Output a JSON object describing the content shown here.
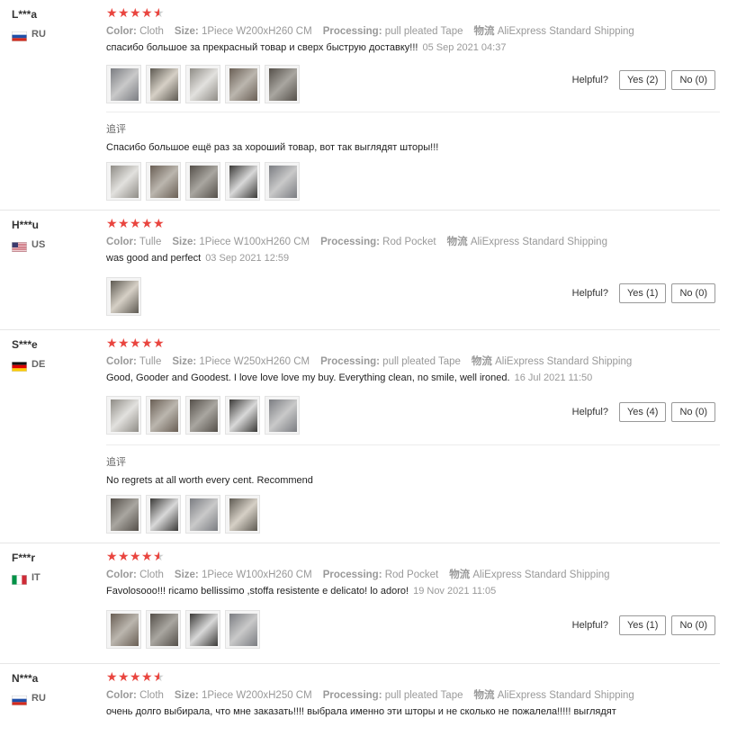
{
  "labels": {
    "color": "Color:",
    "size": "Size:",
    "processing": "Processing:",
    "shipping": "物流",
    "helpful": "Helpful?",
    "followup": "追评"
  },
  "colors": {
    "star": "#e9453f",
    "border": "#e6e6e6"
  },
  "reviews": [
    {
      "user": "L***a",
      "country": "RU",
      "flag": "russia-flag-icon",
      "rating": 4.5,
      "color": "Cloth",
      "size": "1Piece W200xH260 CM",
      "processing": "pull pleated Tape",
      "shipping": "AliExpress Standard Shipping",
      "text": "спасибо большое за прекрасный товар и сверх быструю доставку!!!",
      "date": "05 Sep 2021 04:37",
      "photos": [
        "photo-1",
        "photo-2",
        "photo-3",
        "photo-4",
        "photo-5"
      ],
      "yes": "Yes (2)",
      "no": "No (0)",
      "followup": {
        "text": "Спасибо большое ещё раз за хороший товар, вот так выглядят шторы!!!",
        "photos": [
          "photo-1",
          "photo-2",
          "photo-3",
          "photo-4",
          "photo-5"
        ]
      }
    },
    {
      "user": "H***u",
      "country": "US",
      "flag": "usa-flag-icon",
      "rating": 5,
      "color": "Tulle",
      "size": "1Piece W100xH260 CM",
      "processing": "Rod Pocket",
      "shipping": "AliExpress Standard Shipping",
      "text": "was good and perfect",
      "date": "03 Sep 2021 12:59",
      "photos": [
        "photo-1"
      ],
      "yes": "Yes (1)",
      "no": "No (0)"
    },
    {
      "user": "S***e",
      "country": "DE",
      "flag": "germany-flag-icon",
      "rating": 5,
      "color": "Tulle",
      "size": "1Piece W250xH260 CM",
      "processing": "pull pleated Tape",
      "shipping": "AliExpress Standard Shipping",
      "text": "Good, Gooder and Goodest. I love love love my buy. Everything clean, no smile, well ironed.",
      "date": "16 Jul 2021 11:50",
      "photos": [
        "photo-1",
        "photo-2",
        "photo-3",
        "photo-4",
        "photo-5"
      ],
      "yes": "Yes (4)",
      "no": "No (0)",
      "followup": {
        "text": "No regrets at all worth every cent. Recommend",
        "photos": [
          "photo-1",
          "photo-2",
          "photo-3",
          "photo-4"
        ]
      }
    },
    {
      "user": "F***r",
      "country": "IT",
      "flag": "italy-flag-icon",
      "rating": 4.5,
      "color": "Cloth",
      "size": "1Piece W100xH260 CM",
      "processing": "Rod Pocket",
      "shipping": "AliExpress Standard Shipping",
      "text": "Favolosooo!!! ricamo bellissimo ,stoffa resistente e delicato! lo adoro!",
      "date": "19 Nov 2021 11:05",
      "photos": [
        "photo-1",
        "photo-2",
        "photo-3",
        "photo-4"
      ],
      "yes": "Yes (1)",
      "no": "No (0)"
    },
    {
      "user": "N***a",
      "country": "RU",
      "flag": "russia-flag-icon",
      "rating": 4.5,
      "color": "Cloth",
      "size": "1Piece W200xH250 CM",
      "processing": "pull pleated Tape",
      "shipping": "AliExpress Standard Shipping",
      "text": "очень долго выбирала, что мне заказать!!!! выбрала именно эти шторы и не сколько не пожалела!!!!! выглядят",
      "date": "",
      "photos": []
    }
  ]
}
